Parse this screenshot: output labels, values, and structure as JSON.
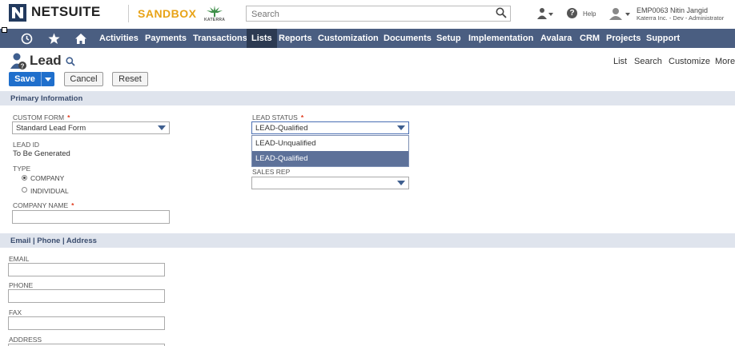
{
  "header": {
    "logo_text": "NETSUITE",
    "environment": "SANDBOX",
    "company_logo_text": "KATERRA",
    "search_placeholder": "Search",
    "help_label": "Help",
    "user_name": "EMP0063 Nitin Jangid",
    "user_role": "Katerra Inc. - Dev - Administrator"
  },
  "nav": {
    "items": [
      "Activities",
      "Payments",
      "Transactions",
      "Lists",
      "Reports",
      "Customization",
      "Documents",
      "Setup",
      "Implementation",
      "Avalara",
      "CRM",
      "Projects",
      "Support"
    ],
    "active": "Lists"
  },
  "page": {
    "title": "Lead",
    "links": [
      "List",
      "Search",
      "Customize",
      "More"
    ]
  },
  "buttons": {
    "save": "Save",
    "cancel": "Cancel",
    "reset": "Reset"
  },
  "sections": {
    "primary": "Primary Information",
    "contact": "Email | Phone | Address"
  },
  "form": {
    "custom_form_label": "CUSTOM FORM",
    "custom_form_value": "Standard Lead Form",
    "lead_id_label": "LEAD ID",
    "lead_id_value": "To Be Generated",
    "type_label": "TYPE",
    "type_options": [
      "COMPANY",
      "INDIVIDUAL"
    ],
    "type_selected": "COMPANY",
    "company_name_label": "COMPANY NAME",
    "lead_status_label": "LEAD STATUS",
    "lead_status_value": "LEAD-Qualified",
    "lead_status_options": [
      "LEAD-Unqualified",
      "LEAD-Qualified"
    ],
    "sales_rep_label": "SALES REP",
    "email_label": "EMAIL",
    "phone_label": "PHONE",
    "fax_label": "FAX",
    "address_label": "ADDRESS",
    "required_mark": "*"
  },
  "colors": {
    "nav_bg": "#4a5e81",
    "nav_active": "#2c3a52",
    "save_blue": "#1f6fcc",
    "section_bg": "#dfe4ed",
    "sandbox": "#e8a317",
    "required": "#e0391b",
    "dropdown_selected": "#5d7199"
  }
}
